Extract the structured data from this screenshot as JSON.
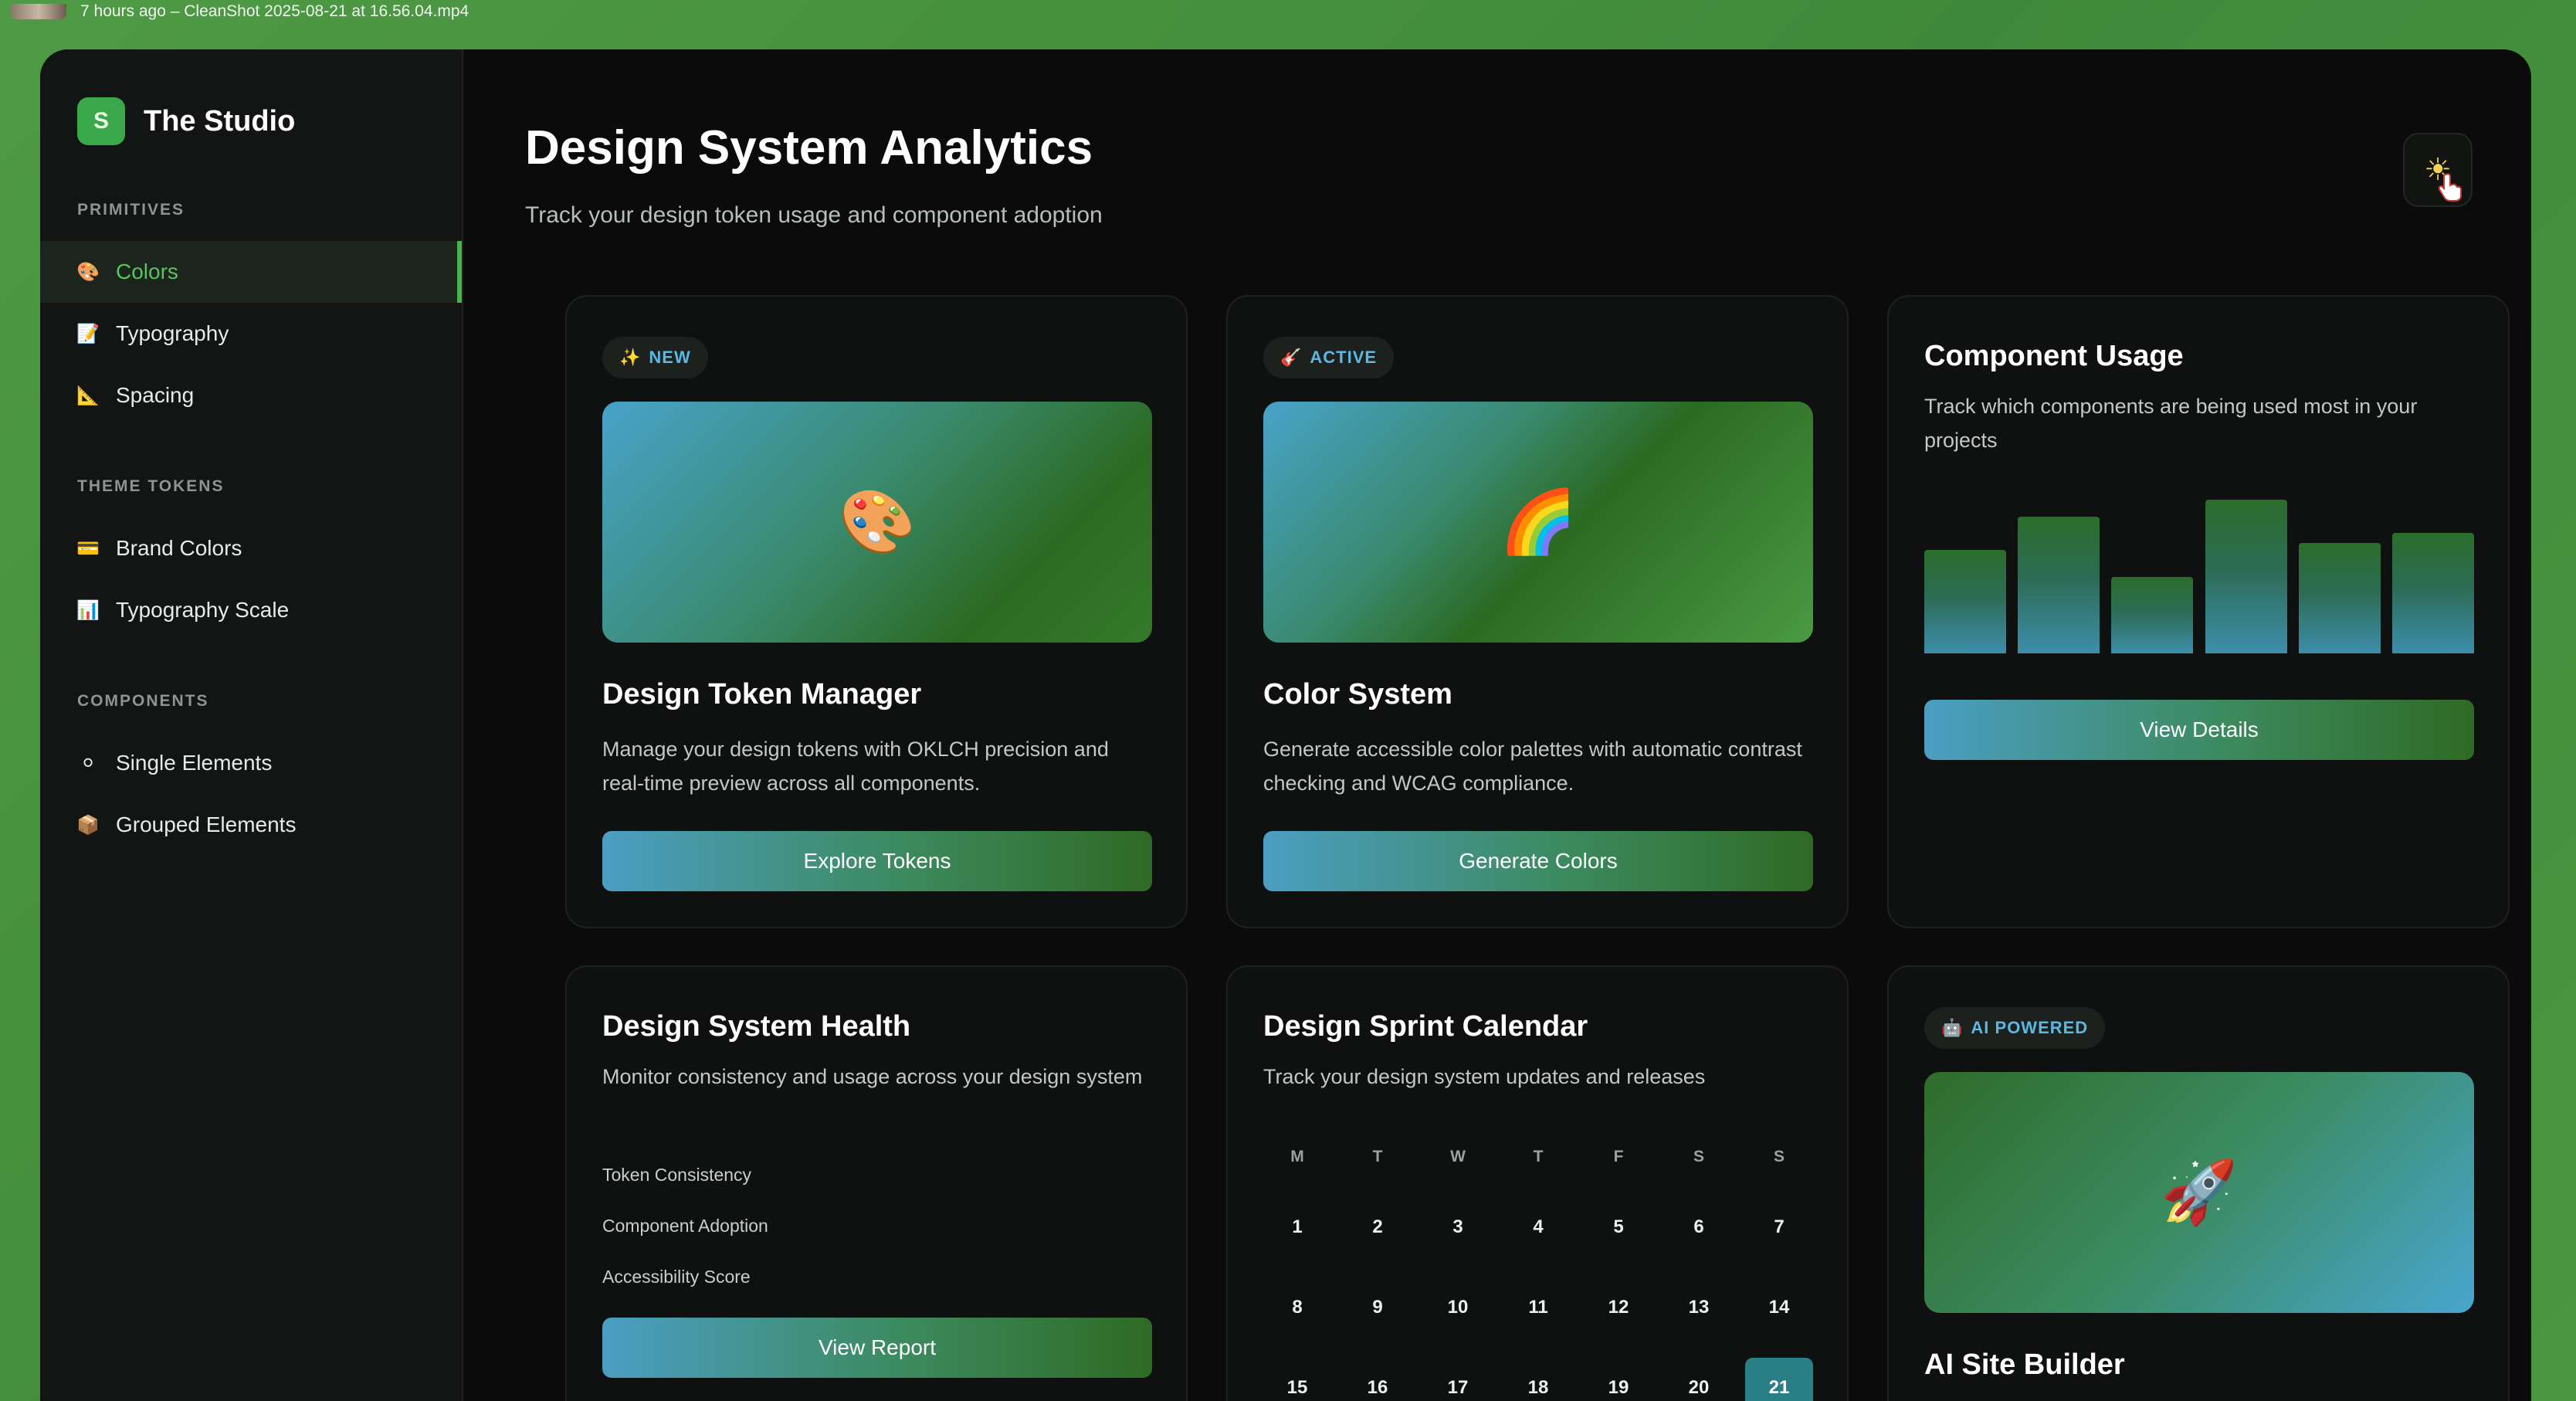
{
  "topbar": {
    "text": "7 hours ago – CleanShot 2025-08-21 at 16.56.04.mp4"
  },
  "brand": {
    "logo_letter": "S",
    "name": "The Studio",
    "accent": "#39a84a"
  },
  "sidebar": {
    "sections": [
      {
        "label": "PRIMITIVES",
        "items": [
          {
            "label": "Colors",
            "icon": "palette-icon",
            "active": true
          },
          {
            "label": "Typography",
            "icon": "document-icon"
          },
          {
            "label": "Spacing",
            "icon": "ruler-icon"
          }
        ]
      },
      {
        "label": "THEME TOKENS",
        "items": [
          {
            "label": "Brand Colors",
            "icon": "card-icon"
          },
          {
            "label": "Typography Scale",
            "icon": "bar-chart-icon"
          }
        ]
      },
      {
        "label": "COMPONENTS",
        "items": [
          {
            "label": "Single Elements",
            "icon": "circle-icon"
          },
          {
            "label": "Grouped Elements",
            "icon": "package-icon"
          }
        ]
      }
    ]
  },
  "header": {
    "title": "Design System Analytics",
    "subtitle": "Track your design token usage and component adoption",
    "theme_toggle_icon": "sun-icon"
  },
  "cards": {
    "token_manager": {
      "badge": "NEW",
      "badge_icon": "sparkles-icon",
      "hero_icon": "palette-icon",
      "title": "Design Token Manager",
      "description": "Manage your design tokens with OKLCH precision and real-time preview across all components.",
      "button": "Explore Tokens"
    },
    "color_system": {
      "badge": "ACTIVE",
      "badge_icon": "guitar-icon",
      "hero_icon": "rainbow-icon",
      "title": "Color System",
      "description": "Generate accessible color palettes with automatic contrast checking and WCAG compliance.",
      "button": "Generate Colors"
    },
    "component_usage": {
      "title": "Component Usage",
      "description": "Track which components are being used most in your projects",
      "button": "View Details"
    },
    "health": {
      "title": "Design System Health",
      "description": "Monitor consistency and usage across your design system",
      "metrics": [
        "Token Consistency",
        "Component Adoption",
        "Accessibility Score"
      ],
      "button": "View Report"
    },
    "calendar": {
      "title": "Design Sprint Calendar",
      "description": "Track your design system updates and releases",
      "weekdays": [
        "M",
        "T",
        "W",
        "T",
        "F",
        "S",
        "S"
      ],
      "days": [
        "1",
        "2",
        "3",
        "4",
        "5",
        "6",
        "7",
        "8",
        "9",
        "10",
        "11",
        "12",
        "13",
        "14",
        "15",
        "16",
        "17",
        "18",
        "19",
        "20",
        "21"
      ],
      "today": "21"
    },
    "site_builder": {
      "badge": "AI POWERED",
      "badge_icon": "robot-icon",
      "hero_icon": "rocket-icon",
      "title": "AI Site Builder"
    }
  },
  "chart_data": {
    "type": "bar",
    "title": "",
    "categories": [
      "",
      "",
      "",
      "",
      "",
      ""
    ],
    "values": [
      62,
      82,
      46,
      92,
      66,
      72
    ],
    "ylim": [
      0,
      100
    ],
    "grid": false
  }
}
